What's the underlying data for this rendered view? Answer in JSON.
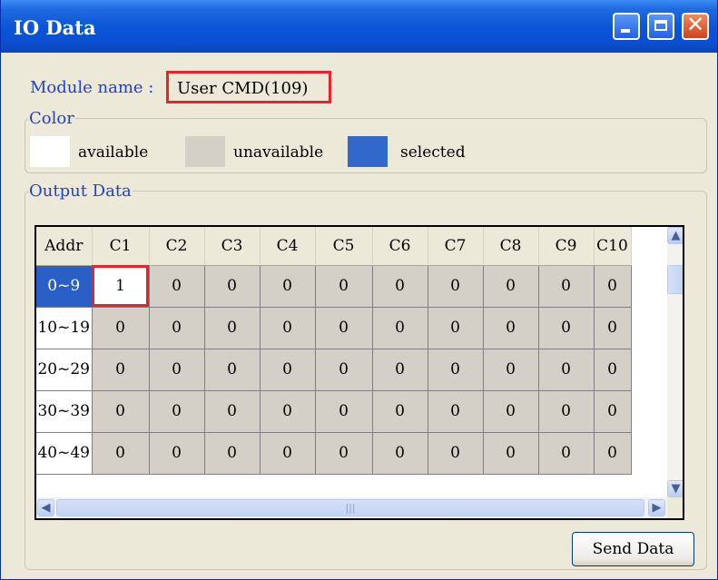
{
  "window": {
    "title": "IO Data"
  },
  "module": {
    "label": "Module name :",
    "value": "User CMD(109)"
  },
  "color_group": {
    "legend": "Color",
    "items": [
      {
        "label": "available",
        "color": "#ffffff"
      },
      {
        "label": "unavailable",
        "color": "#d4d0c8"
      },
      {
        "label": "selected",
        "color": "#3168c9"
      }
    ]
  },
  "output_group": {
    "legend": "Output Data"
  },
  "grid": {
    "columns": [
      "Addr",
      "C1",
      "C2",
      "C3",
      "C4",
      "C5",
      "C6",
      "C7",
      "C8",
      "C9",
      "C10"
    ],
    "rows": [
      {
        "addr": "0~9",
        "cells": [
          "1",
          "0",
          "0",
          "0",
          "0",
          "0",
          "0",
          "0",
          "0",
          "0"
        ]
      },
      {
        "addr": "10~19",
        "cells": [
          "0",
          "0",
          "0",
          "0",
          "0",
          "0",
          "0",
          "0",
          "0",
          "0"
        ]
      },
      {
        "addr": "20~29",
        "cells": [
          "0",
          "0",
          "0",
          "0",
          "0",
          "0",
          "0",
          "0",
          "0",
          "0"
        ]
      },
      {
        "addr": "30~39",
        "cells": [
          "0",
          "0",
          "0",
          "0",
          "0",
          "0",
          "0",
          "0",
          "0",
          "0"
        ]
      },
      {
        "addr": "40~49",
        "cells": [
          "0",
          "0",
          "0",
          "0",
          "0",
          "0",
          "0",
          "0",
          "0",
          "0"
        ]
      }
    ],
    "selected_row": 0,
    "highlighted_cell": [
      0,
      0
    ]
  },
  "buttons": {
    "send": "Send Data"
  },
  "colors": {
    "title_bar": "#0a54d6",
    "highlight": "#e8232a",
    "selected": "#3168c9",
    "label_blue": "#1f3fd6"
  }
}
